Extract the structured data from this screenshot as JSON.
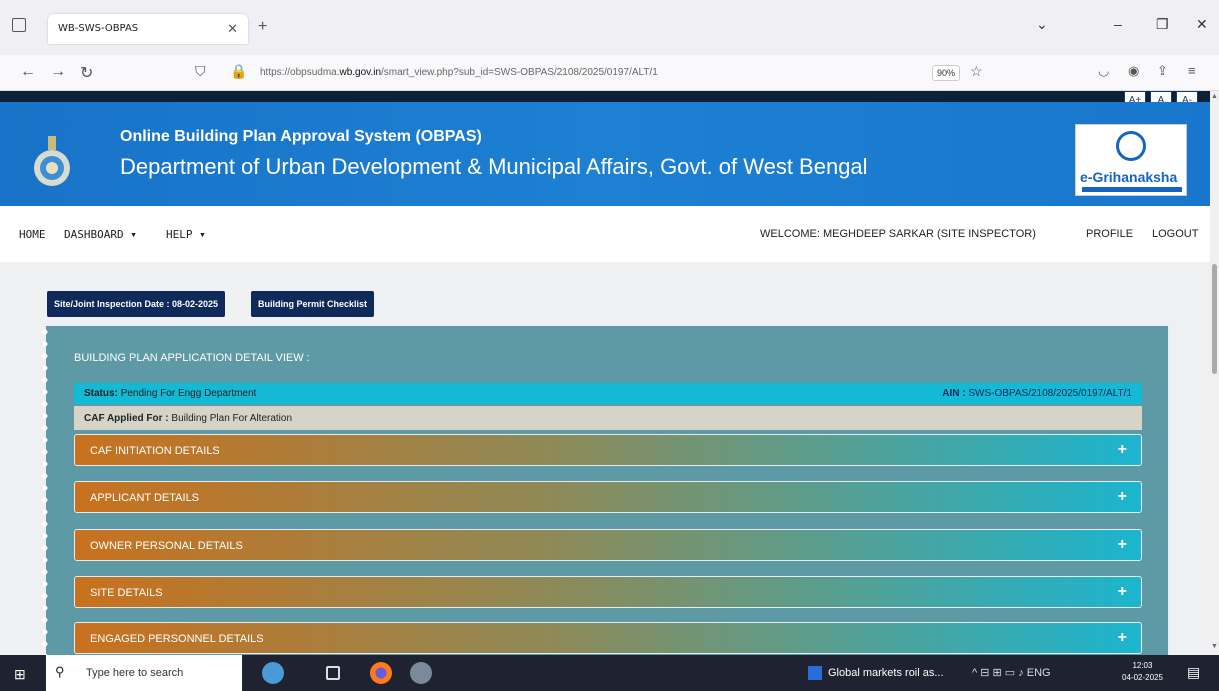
{
  "browser": {
    "tab_title": "WB-SWS-OBPAS",
    "url_prefix": "https://obpsudma.",
    "url_domain": "wb.gov.in",
    "url_suffix": "/smart_view.php?sub_id=SWS-OBPAS/2108/2025/0197/ALT/1",
    "zoom": "90%"
  },
  "page": {
    "font_buttons": [
      "A+",
      "A",
      "A-"
    ],
    "banner_title": "Online Building Plan Approval System (OBPAS)",
    "banner_dept": "Department of Urban Development & Municipal Affairs, Govt. of West Bengal",
    "logo_text": "e-Grihanaksha",
    "menu": {
      "home": "HOME",
      "dashboard": "DASHBOARD ▾",
      "help": "HELP ▾",
      "welcome": "WELCOME: MEGHDEEP SARKAR (SITE INSPECTOR)",
      "profile": "PROFILE",
      "logout": "LOGOUT"
    },
    "btn_inspection": "Site/Joint Inspection Date : 08-02-2025",
    "btn_checklist": "Building Permit Checklist",
    "panel_heading": "BUILDING PLAN APPLICATION DETAIL VIEW :",
    "status_label": "Status:",
    "status_value": "Pending For Engg Department",
    "ain_label": "AIN :",
    "ain_value": "SWS-OBPAS/2108/2025/0197/ALT/1",
    "caf_label": "CAF Applied For :",
    "caf_value": "Building Plan For Alteration",
    "sections": [
      "CAF INITIATION DETAILS",
      "APPLICANT DETAILS",
      "OWNER PERSONAL DETAILS",
      "SITE DETAILS",
      "ENGAGED PERSONNEL DETAILS"
    ]
  },
  "taskbar": {
    "search_placeholder": "Type here to search",
    "news": "Global markets roil as...",
    "lang": "ENG",
    "time": "12:03",
    "date": "04-02-2025"
  }
}
